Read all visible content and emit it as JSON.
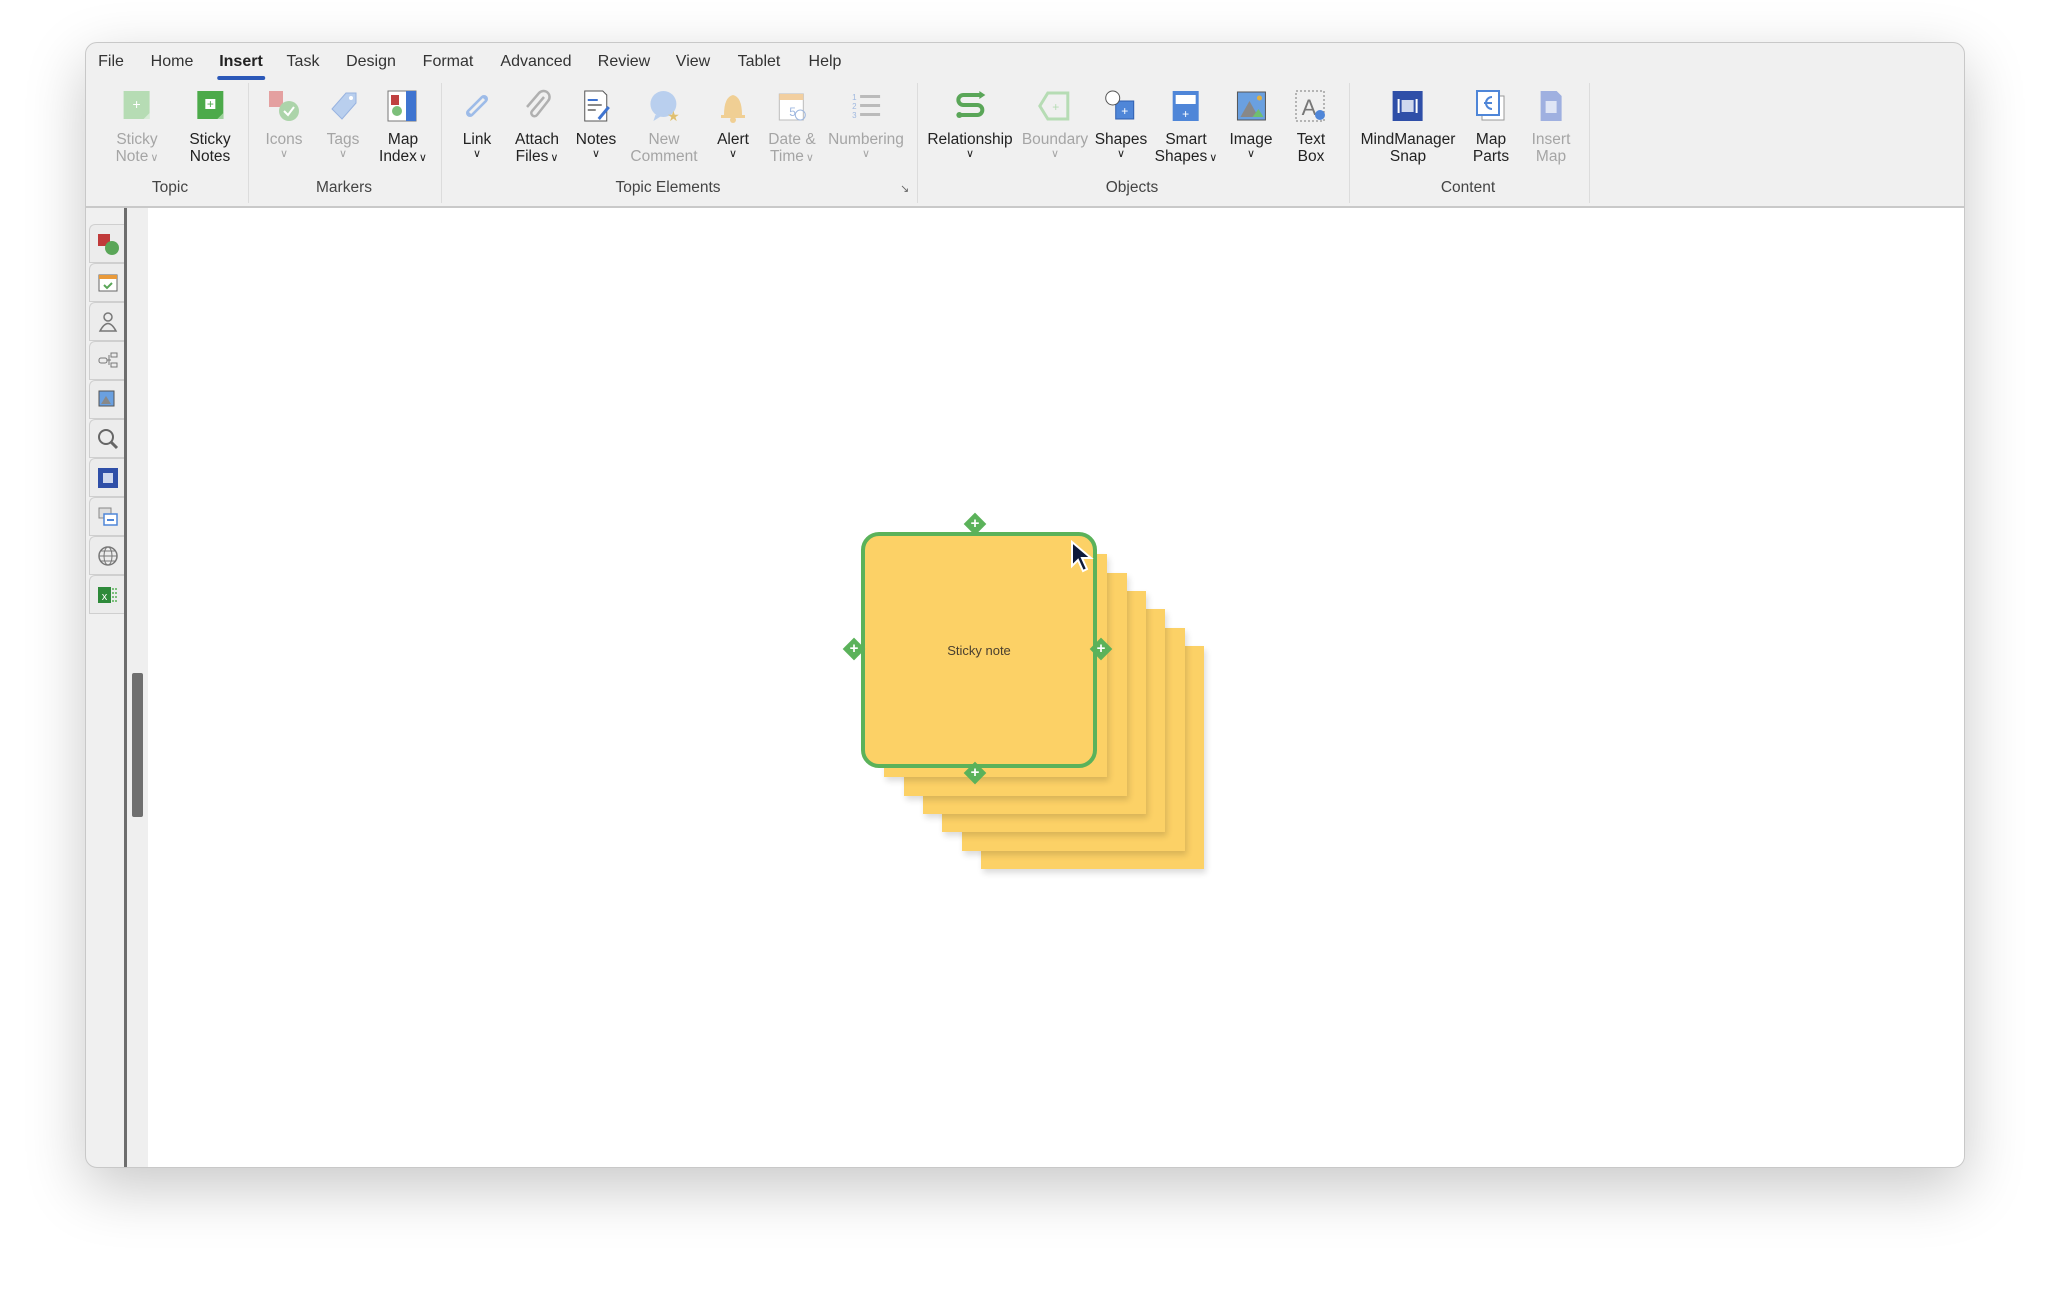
{
  "menu": {
    "tabs": [
      {
        "label": "File"
      },
      {
        "label": "Home"
      },
      {
        "label": "Insert",
        "active": true
      },
      {
        "label": "Task"
      },
      {
        "label": "Design"
      },
      {
        "label": "Format"
      },
      {
        "label": "Advanced"
      },
      {
        "label": "Review"
      },
      {
        "label": "View"
      },
      {
        "label": "Tablet"
      },
      {
        "label": "Help"
      }
    ]
  },
  "ribbon": {
    "buttons": [
      {
        "id": "sticky-note",
        "l1": "Sticky",
        "l2": "Note",
        "icon": "sticky-note-icon",
        "disabled": true,
        "dropdown": "inline"
      },
      {
        "id": "sticky-notes",
        "l1": "Sticky",
        "l2": "Notes",
        "icon": "sticky-notes-icon"
      },
      {
        "id": "icons",
        "l1": "Icons",
        "icon": "icons-marker-icon",
        "disabled": true,
        "dropdown": "below"
      },
      {
        "id": "tags",
        "l1": "Tags",
        "icon": "tag-icon",
        "disabled": true,
        "dropdown": "below"
      },
      {
        "id": "map-index",
        "l1": "Map",
        "l2": "Index",
        "icon": "map-index-icon",
        "dropdown": "inline"
      },
      {
        "id": "link",
        "l1": "Link",
        "icon": "link-icon",
        "dropdown": "below"
      },
      {
        "id": "attach-files",
        "l1": "Attach",
        "l2": "Files",
        "icon": "paperclip-icon",
        "dropdown": "inline"
      },
      {
        "id": "notes",
        "l1": "Notes",
        "icon": "notes-icon",
        "dropdown": "below"
      },
      {
        "id": "new-comment",
        "l1": "New",
        "l2": "Comment",
        "icon": "comment-icon",
        "disabled": true
      },
      {
        "id": "alert",
        "l1": "Alert",
        "icon": "bell-icon",
        "dropdown": "below"
      },
      {
        "id": "date-time",
        "l1": "Date &",
        "l2": "Time",
        "icon": "calendar-icon",
        "disabled": true,
        "dropdown": "inline"
      },
      {
        "id": "numbering",
        "l1": "Numbering",
        "icon": "numbering-icon",
        "disabled": true,
        "dropdown": "below"
      },
      {
        "id": "relationship",
        "l1": "Relationship",
        "icon": "relationship-icon",
        "dropdown": "below"
      },
      {
        "id": "boundary",
        "l1": "Boundary",
        "icon": "boundary-icon",
        "disabled": true,
        "dropdown": "below"
      },
      {
        "id": "shapes",
        "l1": "Shapes",
        "icon": "shapes-icon",
        "dropdown": "below"
      },
      {
        "id": "smart-shapes",
        "l1": "Smart",
        "l2": "Shapes",
        "icon": "smart-shapes-icon",
        "dropdown": "inline"
      },
      {
        "id": "image",
        "l1": "Image",
        "icon": "image-icon",
        "dropdown": "below"
      },
      {
        "id": "text-box",
        "l1": "Text",
        "l2": "Box",
        "icon": "text-box-icon"
      },
      {
        "id": "mindmanager-snap",
        "l1": "MindManager",
        "l2": "Snap",
        "icon": "snap-icon"
      },
      {
        "id": "map-parts",
        "l1": "Map",
        "l2": "Parts",
        "icon": "map-parts-icon"
      },
      {
        "id": "insert-map",
        "l1": "Insert",
        "l2": "Map",
        "icon": "insert-map-icon",
        "disabled": true
      }
    ],
    "groups": [
      "Topic",
      "Markers",
      "Topic Elements",
      "Objects",
      "Content"
    ]
  },
  "sidebar": {
    "tabs": [
      "markers-icon",
      "task-calendar-icon",
      "resource-person-icon",
      "map-parts-icon",
      "library-image-icon",
      "search-icon",
      "snap-icon",
      "outline-icon",
      "browser-globe-icon",
      "excel-icon"
    ]
  },
  "canvas": {
    "topic_text": "Sticky note",
    "note_color": "#fcd166",
    "selection_color": "#5bb25a"
  },
  "colors": {
    "accent": "#2b58b8"
  }
}
